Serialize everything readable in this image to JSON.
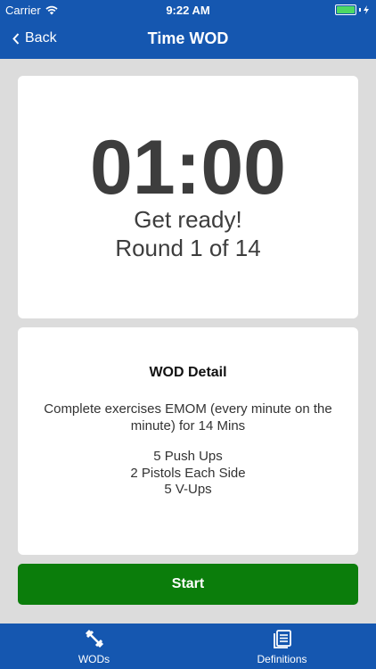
{
  "status_bar": {
    "carrier": "Carrier",
    "time": "9:22 AM",
    "battery_color": "#4cd964"
  },
  "nav": {
    "back_label": "Back",
    "title": "Time WOD",
    "bar_color": "#1557b0"
  },
  "timer": {
    "display": "01:00",
    "status": "Get ready!",
    "round": "Round 1 of 14"
  },
  "detail": {
    "title": "WOD Detail",
    "description": "Complete exercises EMOM (every minute on the minute) for 14 Mins",
    "exercises": [
      "5 Push Ups",
      "2 Pistols Each Side",
      "5 V-Ups"
    ]
  },
  "start_button": {
    "label": "Start",
    "color": "#0b7d0b"
  },
  "tabs": [
    {
      "label": "WODs",
      "icon": "dumbbell-icon"
    },
    {
      "label": "Definitions",
      "icon": "definitions-icon"
    }
  ]
}
